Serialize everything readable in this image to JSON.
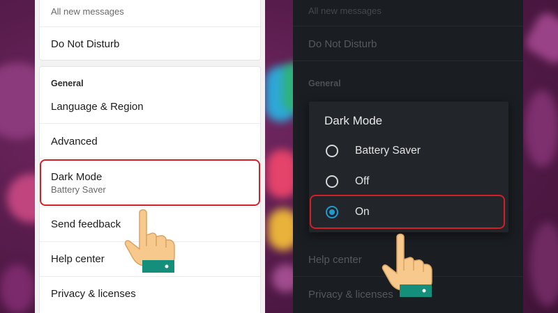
{
  "light_screen": {
    "top_card": {
      "notifications_subtitle": "All new messages",
      "do_not_disturb": "Do Not Disturb"
    },
    "section_header": "General",
    "items": [
      {
        "label": "Language & Region"
      },
      {
        "label": "Advanced"
      },
      {
        "label": "Dark Mode",
        "sub": "Battery Saver"
      },
      {
        "label": "Send feedback"
      },
      {
        "label": "Help center"
      },
      {
        "label": "Privacy & licenses"
      }
    ]
  },
  "dark_screen": {
    "notifications_subtitle": "All new messages",
    "do_not_disturb": "Do Not Disturb",
    "section_header": "General",
    "help_center": "Help center",
    "privacy": "Privacy & licenses",
    "dialog": {
      "title": "Dark Mode",
      "options": [
        {
          "label": "Battery Saver",
          "selected": false
        },
        {
          "label": "Off",
          "selected": false
        },
        {
          "label": "On",
          "selected": true
        }
      ]
    }
  },
  "colors": {
    "highlight": "#d41f26",
    "radio_selected": "#1d9bd1",
    "background": "#5a1f4e"
  },
  "icons": [
    "pointing-hand-icon",
    "radio-button-icon"
  ]
}
